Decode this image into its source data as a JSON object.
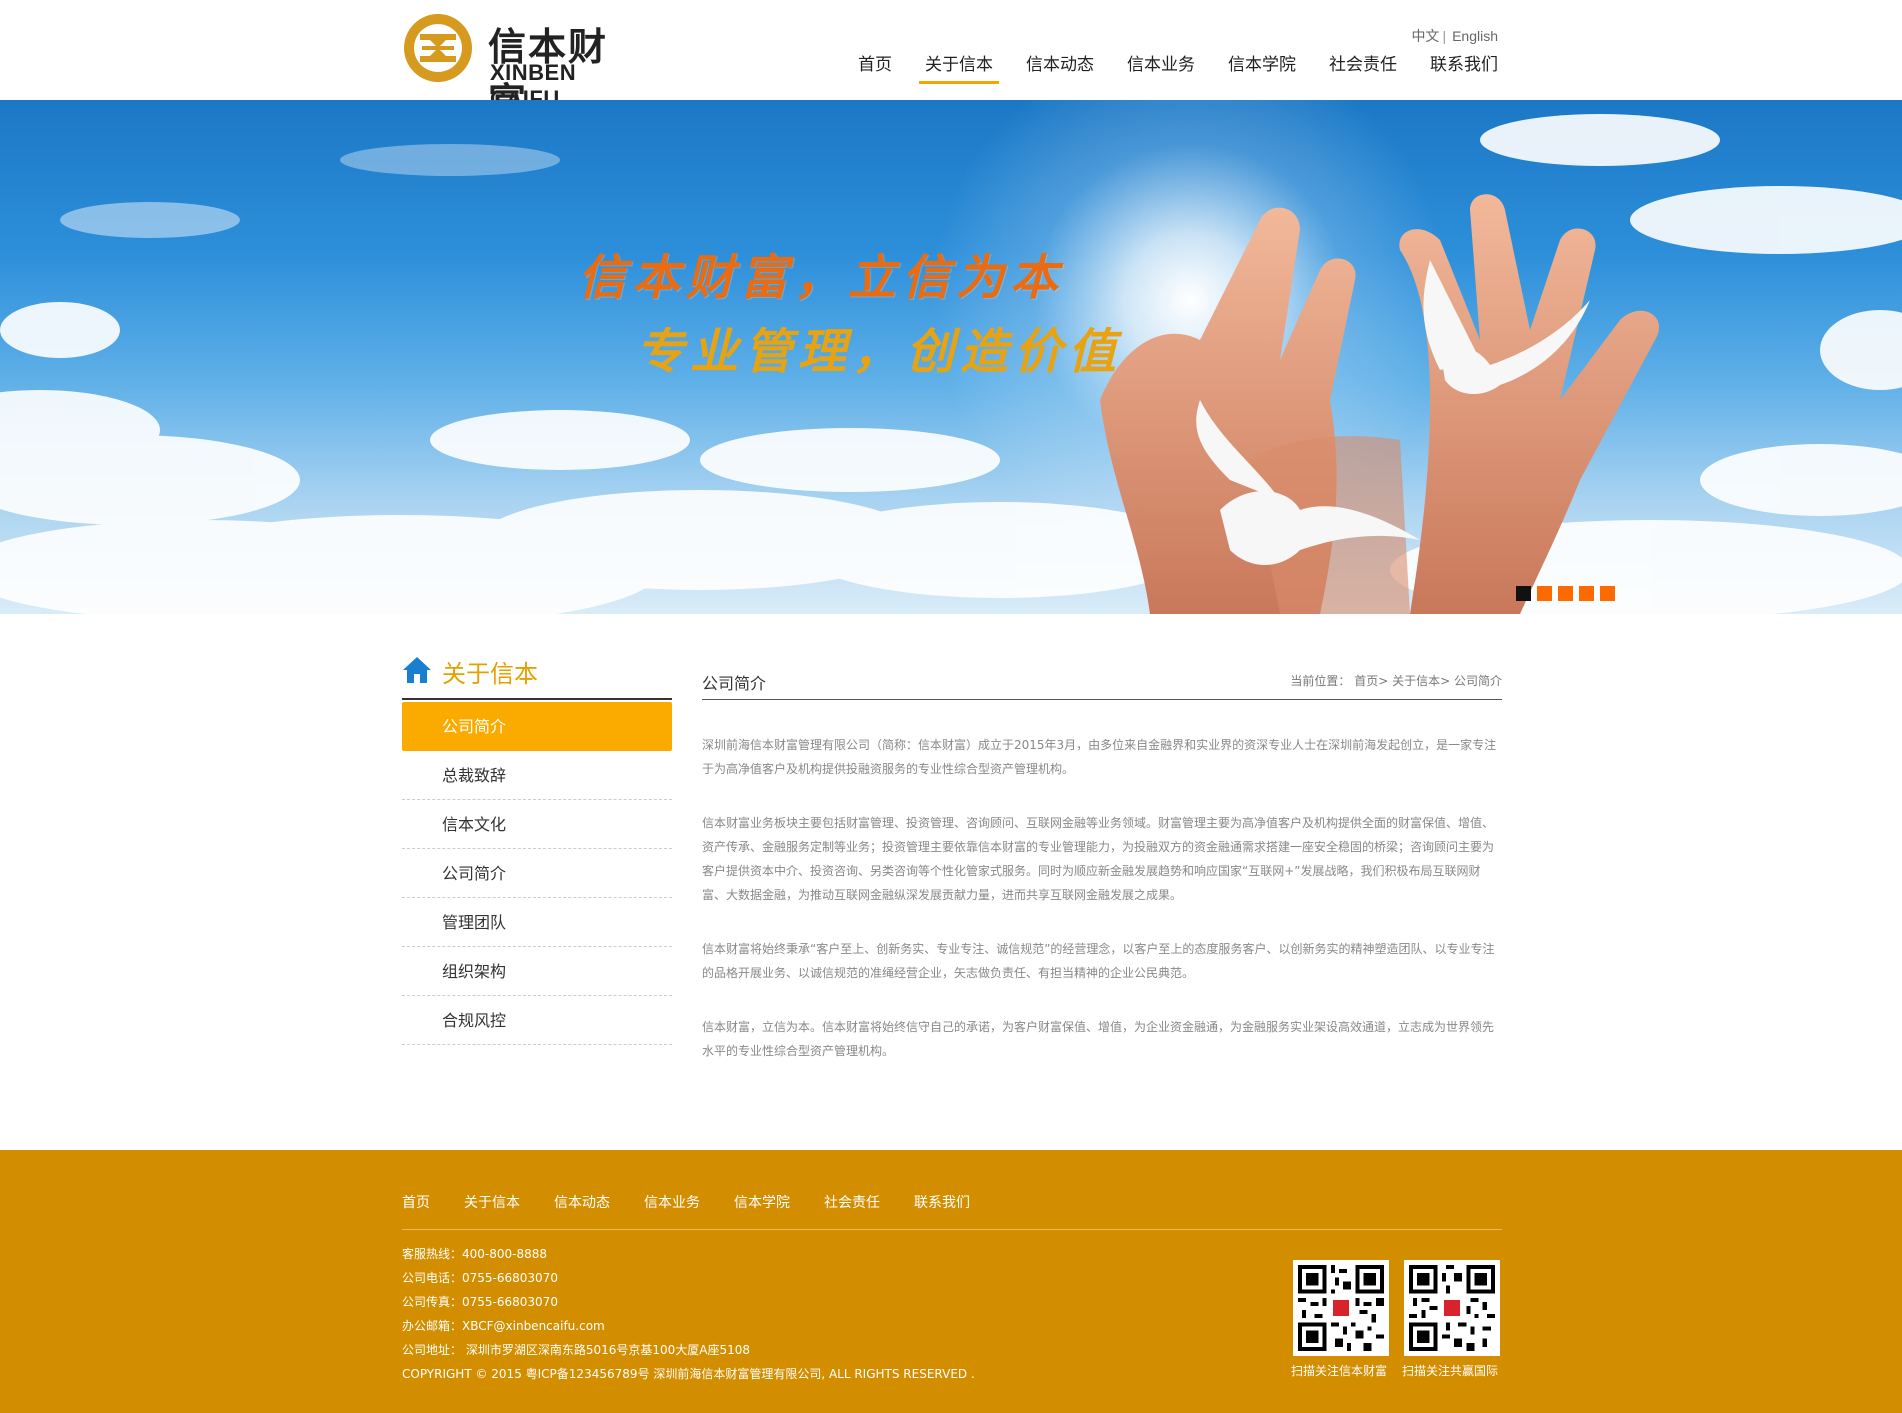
{
  "header": {
    "logo_cn": "信本财富",
    "logo_en": "XINBEN CAIFU",
    "lang_cn": "中文",
    "lang_sep": "|",
    "lang_en": "English",
    "nav": [
      "首页",
      "关于信本",
      "信本动态",
      "信本业务",
      "信本学院",
      "社会责任",
      "联系我们"
    ],
    "nav_active_index": 1
  },
  "banner": {
    "slogan_line1": "信本财富，立信为本",
    "slogan_line2": "专业管理，创造价值",
    "dots_count": 5,
    "active_dot": 0
  },
  "sidebar": {
    "title": "关于信本",
    "items": [
      "公司简介",
      "总裁致辞",
      "信本文化",
      "公司简介",
      "管理团队",
      "组织架构",
      "合规风控"
    ],
    "active_index": 0
  },
  "main": {
    "title": "公司简介",
    "crumb_prefix": "当前位置：",
    "crumb_home": "首页",
    "crumb_section": "关于信本",
    "crumb_current": "公司简介",
    "paragraphs": [
      "深圳前海信本财富管理有限公司（简称：信本财富）成立于2015年3月，由多位来自金融界和实业界的资深专业人士在深圳前海发起创立，是一家专注于为高净值客户及机构提供投融资服务的专业性综合型资产管理机构。",
      "信本财富业务板块主要包括财富管理、投资管理、咨询顾问、互联网金融等业务领域。财富管理主要为高净值客户及机构提供全面的财富保值、增值、资产传承、金融服务定制等业务；投资管理主要依靠信本财富的专业管理能力，为投融双方的资金融通需求搭建一座安全稳固的桥梁；咨询顾问主要为客户提供资本中介、投资咨询、另类咨询等个性化管家式服务。同时为顺应新金融发展趋势和响应国家“互联网+”发展战略，我们积极布局互联网财富、大数据金融，为推动互联网金融纵深发展贡献力量，进而共享互联网金融发展之成果。",
      "信本财富将始终秉承“客户至上、创新务实、专业专注、诚信规范”的经营理念，以客户至上的态度服务客户、以创新务实的精神塑造团队、以专业专注的品格开展业务、以诚信规范的准绳经营企业，矢志做负责任、有担当精神的企业公民典范。",
      "信本财富，立信为本。信本财富将始终信守自己的承诺，为客户财富保值、增值，为企业资金融通，为金融服务实业架设高效通道，立志成为世界领先水平的专业性综合型资产管理机构。"
    ]
  },
  "footer": {
    "nav": [
      "首页",
      "关于信本",
      "信本动态",
      "信本业务",
      "信本学院",
      "社会责任",
      "联系我们"
    ],
    "info": [
      "客服热线：400-800-8888",
      "公司电话：0755-66803070",
      "公司传真：0755-66803070",
      "办公邮箱：XBCF@xinbencaifu.com",
      "公司地址： 深圳市罗湖区深南东路5016号京基100大厦A座5108",
      "COPYRIGHT © 2015 粤ICP备123456789号 深圳前海信本财富管理有限公司, ALL RIGHTS RESERVED ."
    ],
    "qr1_caption": "扫描关注信本财富",
    "qr2_caption": "扫描关注共赢国际"
  },
  "colors": {
    "accent": "#f5a400",
    "sidebar_active": "#fbab00",
    "footer_bg": "#d38e00",
    "banner_dot": "#ff6a00",
    "slogan_orange": "#e96b12",
    "slogan_gold": "#e8a313"
  }
}
